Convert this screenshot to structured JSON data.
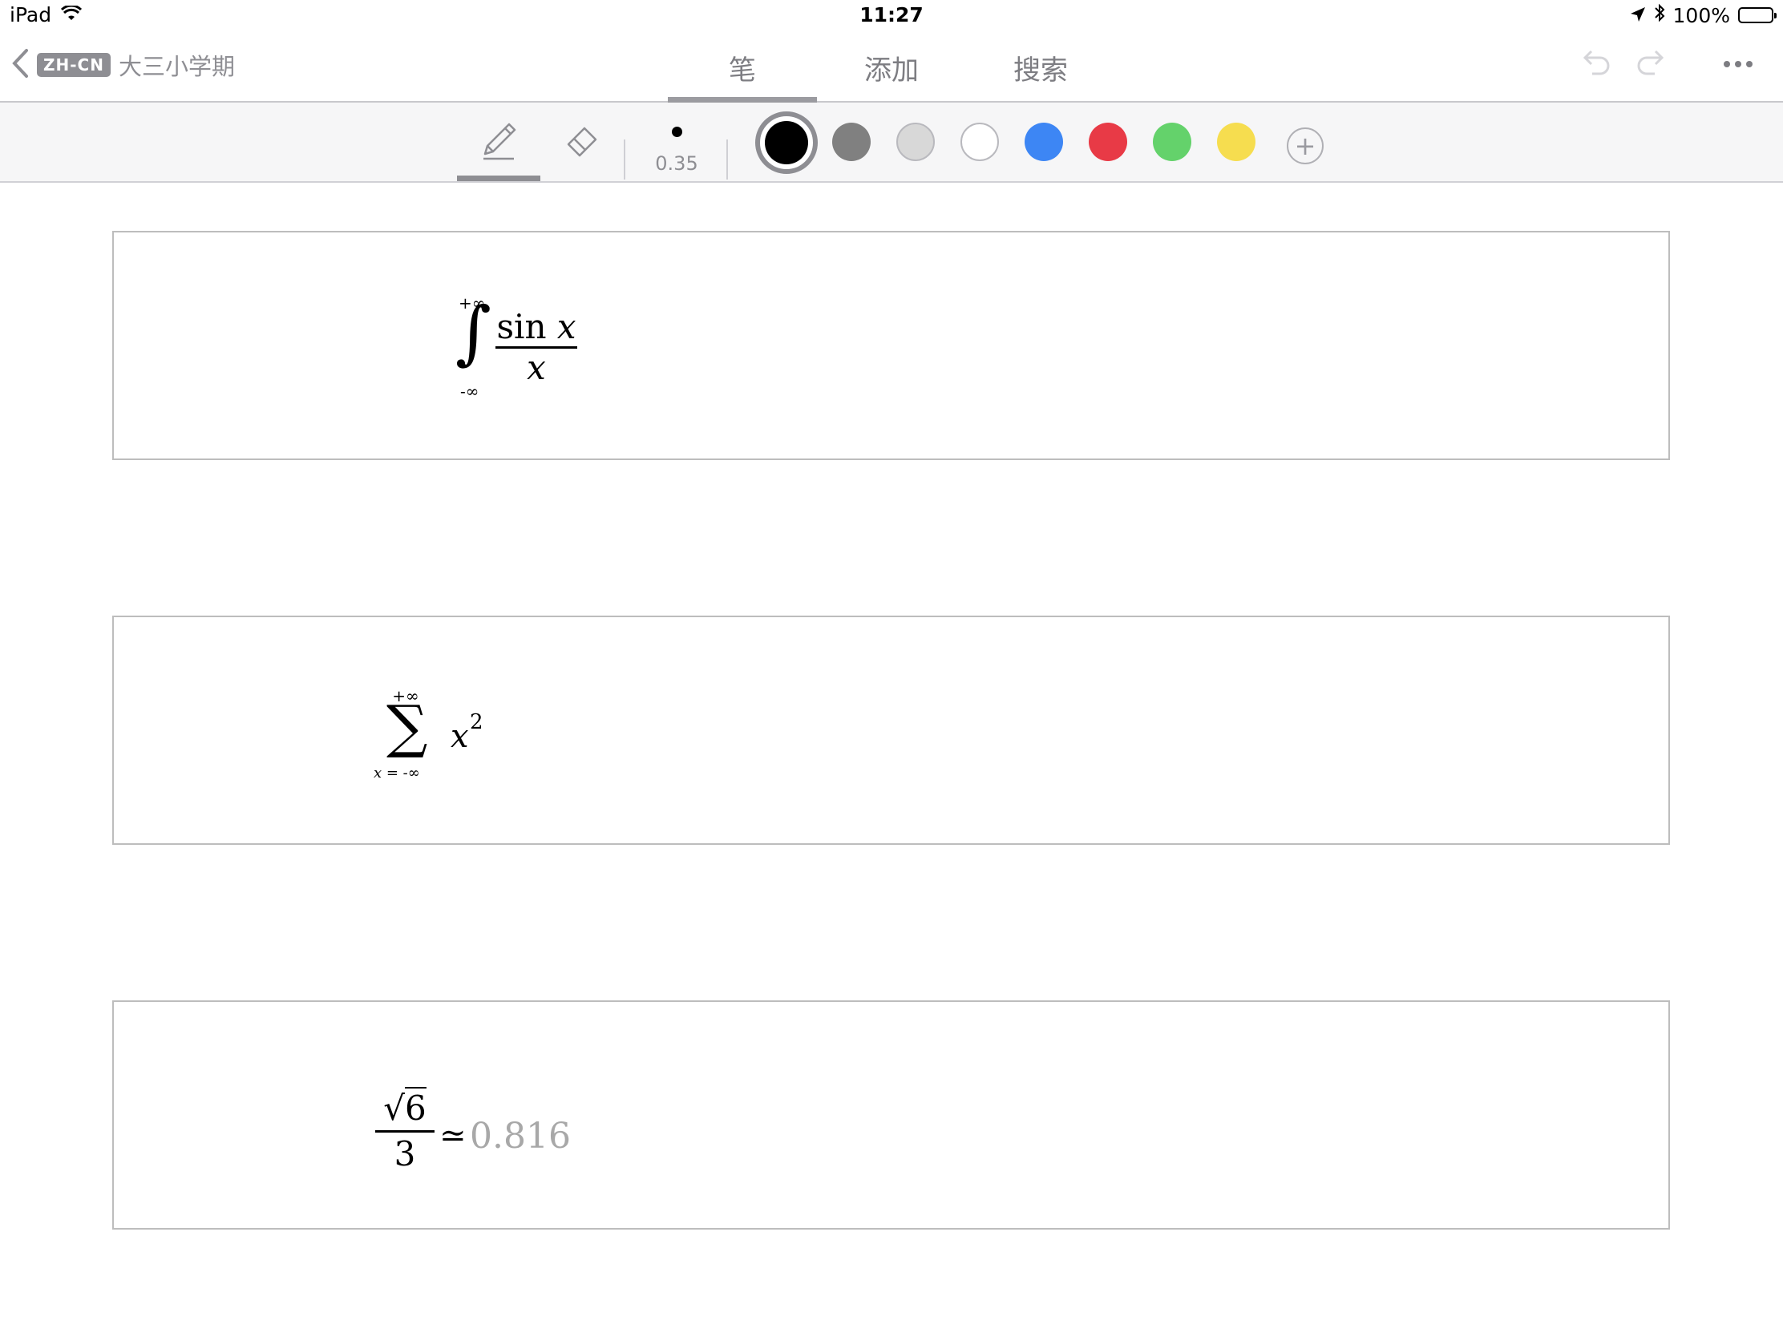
{
  "status_bar": {
    "device": "iPad",
    "time": "11:27",
    "battery": "100%"
  },
  "nav": {
    "tag": "ZH-CN",
    "notebook_title": "大三小学期",
    "tabs": [
      {
        "label": "笔",
        "active": true
      },
      {
        "label": "添加",
        "active": false
      },
      {
        "label": "搜索",
        "active": false
      }
    ]
  },
  "toolbar": {
    "stroke_width": "0.35",
    "colors": [
      "#000000",
      "#808080",
      "#d8d8d8",
      "#ffffff",
      "#3d86f4",
      "#e83a46",
      "#64d26b",
      "#f6dd4f"
    ],
    "selected_color": "#000000"
  },
  "equations": [
    {
      "upper": "+∞",
      "lower": "-∞",
      "numerator_fn": "sin",
      "numerator_var": "x",
      "denominator": "x"
    },
    {
      "upper": "+∞",
      "lower": "x = -∞",
      "base": "x",
      "exponent": "2"
    },
    {
      "radicand": "6",
      "denominator": "3",
      "relation": "≃",
      "result": "0.816"
    }
  ]
}
